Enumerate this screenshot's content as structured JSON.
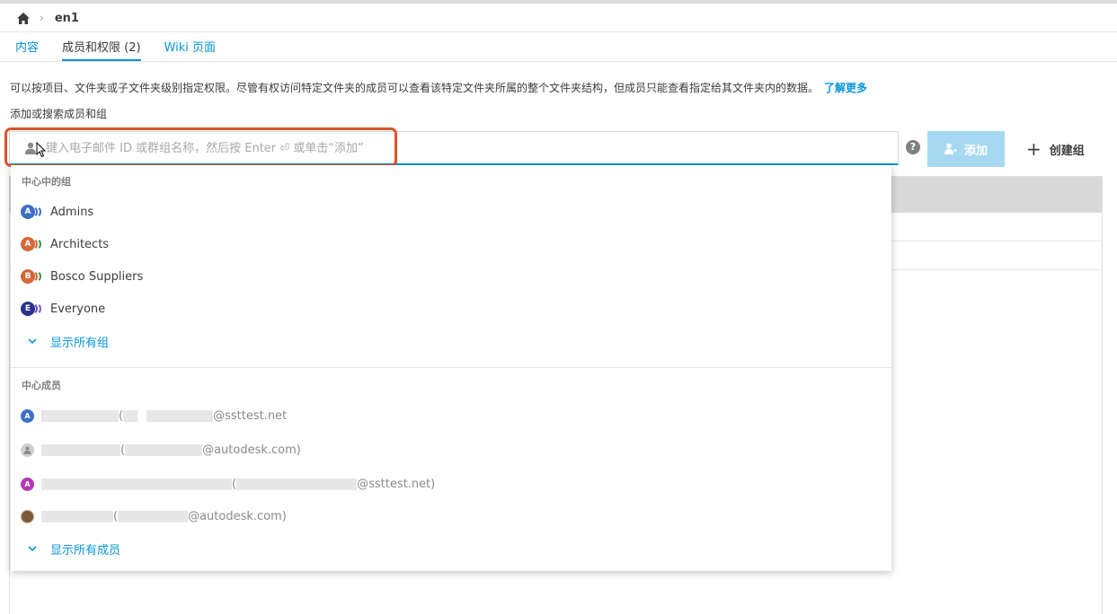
{
  "breadcrumb": {
    "home_icon": "home-icon",
    "current": "en1"
  },
  "tabs": [
    {
      "label": "内容",
      "active": false
    },
    {
      "label": "成员和权限 (2)",
      "active": true
    },
    {
      "label": "Wiki 页面",
      "active": false
    }
  ],
  "description": {
    "text": "可以按项目、文件夹或子文件夹级别指定权限。尽管有权访问特定文件夹的成员可以查看该特定文件夹所属的整个文件夹结构，但成员只能查看指定给其文件夹内的数据。",
    "learn_more": "了解更多"
  },
  "search": {
    "label": "添加或搜索成员和组",
    "placeholder": "键入电子邮件 ID 或群组名称，然后按 Enter ⏎ 或单击“添加”",
    "value": ""
  },
  "actions": {
    "help": "?",
    "add_label": "添加",
    "create_group_label": "创建组"
  },
  "dropdown": {
    "groups_title": "中心中的组",
    "groups": [
      {
        "initial": "A",
        "name": "Admins",
        "color": "#3f6fc4"
      },
      {
        "initial": "A",
        "name": "Architects",
        "color": "#d4673a"
      },
      {
        "initial": "B",
        "name": "Bosco Suppliers",
        "color": "#d4673a"
      },
      {
        "initial": "E",
        "name": "Everyone",
        "color": "#27338a"
      }
    ],
    "show_all_groups": "显示所有组",
    "members_title": "中心成员",
    "members": [
      {
        "initial": "A",
        "avatar_color": "#3f6fc4",
        "email_domain": "@ssttest.net"
      },
      {
        "initial": "",
        "avatar_color": "#cfcfcf",
        "email_domain": "@autodesk.com)"
      },
      {
        "initial": "A",
        "avatar_color": "#b23ab8",
        "email_domain": "@ssttest.net)"
      },
      {
        "initial": "",
        "avatar_color": "#7a5a3a",
        "email_domain": "@autodesk.com)"
      }
    ],
    "show_all_members": "显示所有成员"
  },
  "colors": {
    "accent": "#0696d7",
    "highlight": "#d9542c",
    "add_button_disabled": "#a6d9f1"
  }
}
